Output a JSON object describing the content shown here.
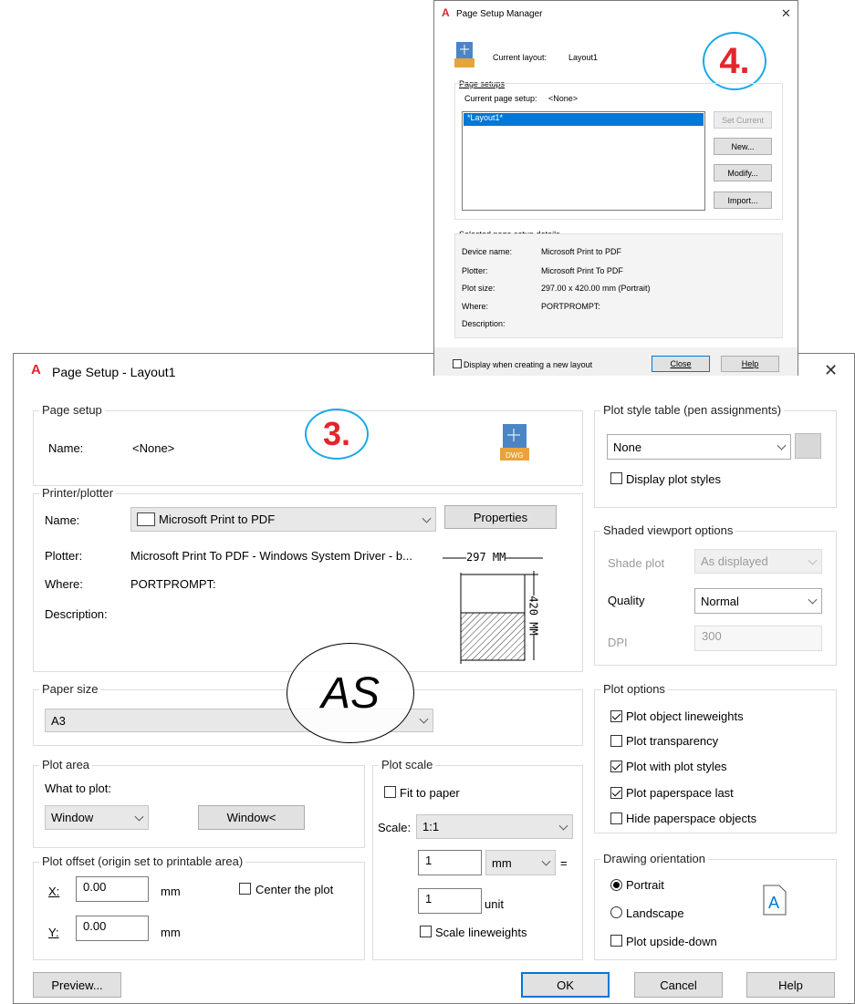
{
  "psm": {
    "title": "Page Setup Manager",
    "close_glyph": "✕",
    "current_layout_label": "Current layout:",
    "current_layout_value": "Layout1",
    "page_setups_label": "Page setups",
    "current_setup_label": "Current page setup:",
    "current_setup_value": "<None>",
    "list_items": [
      "*Layout1*"
    ],
    "buttons": {
      "set_current": "Set Current",
      "new": "New...",
      "modify": "Modify...",
      "import": "Import..."
    },
    "details_label": "Selected page setup details",
    "details": [
      {
        "k": "Device name:",
        "v": "Microsoft Print to PDF"
      },
      {
        "k": "Plotter:",
        "v": "Microsoft Print To PDF"
      },
      {
        "k": "Plot size:",
        "v": "297.00 x 420.00 mm (Portrait)"
      },
      {
        "k": "Where:",
        "v": "PORTPROMPT:"
      },
      {
        "k": "Description:",
        "v": ""
      }
    ],
    "display_new_label": "Display when creating a new layout",
    "close_label": "Close",
    "help_label": "Help",
    "step_badge": "4."
  },
  "ps": {
    "title": "Page Setup - Layout1",
    "close_glyph": "✕",
    "step_badge": "3.",
    "as_badge": "AS",
    "page_setup": {
      "label": "Page setup",
      "name_label": "Name:",
      "name_value": "<None>"
    },
    "printer": {
      "label": "Printer/plotter",
      "name_label": "Name:",
      "name_value": "Microsoft Print to PDF",
      "properties_label": "Properties",
      "plotter_label": "Plotter:",
      "plotter_value": "Microsoft Print To PDF - Windows System Driver - b...",
      "where_label": "Where:",
      "where_value": "PORTPROMPT:",
      "desc_label": "Description:",
      "width_text": "297  MM",
      "height_text": "420  MM"
    },
    "paper_size": {
      "label": "Paper size",
      "value": "A3"
    },
    "plot_area": {
      "label": "Plot area",
      "what_label": "What to plot:",
      "what_value": "Window",
      "window_button": "Window<"
    },
    "plot_offset": {
      "label": "Plot offset (origin set to printable area)",
      "x_label": "X:",
      "x_value": "0.00",
      "y_label": "Y:",
      "y_value": "0.00",
      "unit": "mm",
      "center_label": "Center the plot"
    },
    "plot_scale": {
      "label": "Plot scale",
      "fit_label": "Fit to paper",
      "scale_label": "Scale:",
      "scale_value": "1:1",
      "v1": "1",
      "unit1": "mm",
      "eq": "=",
      "v2": "1",
      "unit2": "unit",
      "lw_label": "Scale lineweights"
    },
    "pst": {
      "label": "Plot style table (pen assignments)",
      "value": "None",
      "display_label": "Display plot styles"
    },
    "shaded": {
      "label": "Shaded viewport options",
      "shade_label": "Shade plot",
      "shade_value": "As displayed",
      "quality_label": "Quality",
      "quality_value": "Normal",
      "dpi_label": "DPI",
      "dpi_value": "300"
    },
    "plot_options": {
      "label": "Plot options",
      "items": [
        {
          "label": "Plot object lineweights",
          "checked": true
        },
        {
          "label": "Plot transparency",
          "checked": false
        },
        {
          "label": "Plot with plot styles",
          "checked": true
        },
        {
          "label": "Plot paperspace last",
          "checked": true
        },
        {
          "label": "Hide paperspace objects",
          "checked": false
        }
      ]
    },
    "orientation": {
      "label": "Drawing orientation",
      "portrait": "Portrait",
      "landscape": "Landscape",
      "upside": "Plot upside-down"
    },
    "buttons": {
      "preview": "Preview...",
      "ok": "OK",
      "cancel": "Cancel",
      "help": "Help"
    }
  },
  "colors": {
    "accent": "#0078d7",
    "autocad_red": "#d9262b",
    "badge_ring": "#19a9e8",
    "selection": "#0078d7"
  }
}
